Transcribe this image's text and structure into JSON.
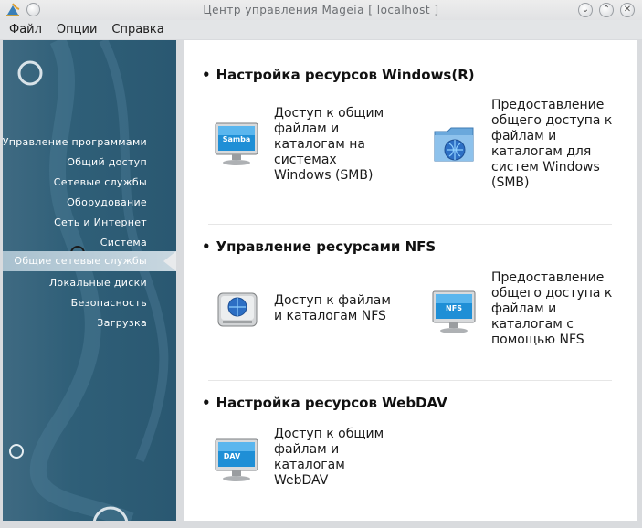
{
  "window": {
    "title": "Центр управления Mageia  [ localhost ]",
    "buttons": [
      "minimize",
      "maximize",
      "close"
    ]
  },
  "menu": {
    "file": "Файл",
    "options": "Опции",
    "help": "Справка"
  },
  "sidebar": {
    "items": [
      {
        "label": "Управление программами"
      },
      {
        "label": "Общий доступ"
      },
      {
        "label": "Сетевые службы"
      },
      {
        "label": "Оборудование"
      },
      {
        "label": "Сеть и Интернет"
      },
      {
        "label": "Система"
      },
      {
        "label": "Общие сетевые службы",
        "selected": true
      },
      {
        "label": "Локальные диски"
      },
      {
        "label": "Безопасность"
      },
      {
        "label": "Загрузка"
      }
    ]
  },
  "main": {
    "sections": [
      {
        "title": "Настройка ресурсов Windows(R)",
        "actions": [
          {
            "label_lines": [
              "Доступ к общим",
              "файлам и",
              "каталогам на",
              "системах",
              "Windows (SMB)"
            ],
            "icon": "samba-monitor-icon",
            "icon_text": "Samba"
          },
          {
            "label_lines": [
              "Предоставление",
              "общего доступа к",
              "файлам и",
              "каталогам для",
              "систем Windows",
              "(SMB)"
            ],
            "icon": "network-folder-icon"
          }
        ]
      },
      {
        "title": "Управление ресурсами NFS",
        "actions": [
          {
            "label_lines": [
              "Доступ к файлам",
              "и каталогам NFS"
            ],
            "icon": "network-drive-icon"
          },
          {
            "label_lines": [
              "Предоставление",
              "общего доступа к",
              "файлам и",
              "каталогам с",
              "помощью NFS"
            ],
            "icon": "nfs-monitor-icon",
            "icon_text": "NFS"
          }
        ]
      },
      {
        "title": "Настройка ресурсов WebDAV",
        "actions": [
          {
            "label_lines": [
              "Доступ к общим",
              "файлам и",
              "каталогам",
              "WebDAV"
            ],
            "icon": "dav-monitor-icon",
            "icon_text": "DAV"
          }
        ]
      }
    ]
  },
  "colors": {
    "sidebar_bg": "#2f5f78",
    "sidebar_selected": "#b5c9d5",
    "content_bg": "#ffffff",
    "monitor_screen": "#1f8fd6"
  }
}
